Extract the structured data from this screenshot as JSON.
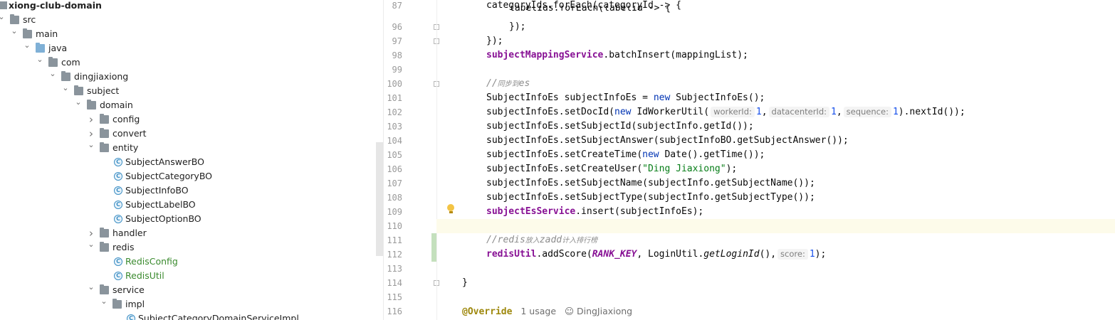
{
  "tree": {
    "root": "xiong-club-domain",
    "items": [
      {
        "label": "src",
        "depth": 0,
        "type": "folder",
        "chevron": "expanded"
      },
      {
        "label": "main",
        "depth": 1,
        "type": "folder",
        "chevron": "expanded"
      },
      {
        "label": "java",
        "depth": 2,
        "type": "src-folder",
        "chevron": "expanded"
      },
      {
        "label": "com",
        "depth": 3,
        "type": "folder",
        "chevron": "expanded"
      },
      {
        "label": "dingjiaxiong",
        "depth": 4,
        "type": "folder",
        "chevron": "expanded"
      },
      {
        "label": "subject",
        "depth": 5,
        "type": "folder",
        "chevron": "expanded"
      },
      {
        "label": "domain",
        "depth": 6,
        "type": "folder",
        "chevron": "expanded"
      },
      {
        "label": "config",
        "depth": 7,
        "type": "folder",
        "chevron": "collapsed"
      },
      {
        "label": "convert",
        "depth": 7,
        "type": "folder",
        "chevron": "collapsed"
      },
      {
        "label": "entity",
        "depth": 7,
        "type": "folder",
        "chevron": "expanded"
      },
      {
        "label": "SubjectAnswerBO",
        "depth": 8,
        "type": "class"
      },
      {
        "label": "SubjectCategoryBO",
        "depth": 8,
        "type": "class"
      },
      {
        "label": "SubjectInfoBO",
        "depth": 8,
        "type": "class"
      },
      {
        "label": "SubjectLabelBO",
        "depth": 8,
        "type": "class"
      },
      {
        "label": "SubjectOptionBO",
        "depth": 8,
        "type": "class"
      },
      {
        "label": "handler",
        "depth": 7,
        "type": "folder",
        "chevron": "collapsed"
      },
      {
        "label": "redis",
        "depth": 7,
        "type": "folder",
        "chevron": "expanded"
      },
      {
        "label": "RedisConfig",
        "depth": 8,
        "type": "class",
        "status": "added"
      },
      {
        "label": "RedisUtil",
        "depth": 8,
        "type": "class",
        "status": "added"
      },
      {
        "label": "service",
        "depth": 7,
        "type": "folder",
        "chevron": "expanded"
      },
      {
        "label": "impl",
        "depth": 8,
        "type": "folder",
        "chevron": "expanded"
      },
      {
        "label": "SubjectCategoryDomainServiceImpl",
        "depth": 9,
        "type": "class"
      }
    ]
  },
  "editor": {
    "lines": [
      {
        "n": "87",
        "indent": "inner",
        "code": "categoryIds.forEach(categoryId -> {"
      },
      {
        "n": "96",
        "indent": "inner2",
        "code": "});"
      },
      {
        "n": "97",
        "indent": "inner",
        "code": "});"
      },
      {
        "n": "98",
        "indent": "inner",
        "field": "subjectMappingService",
        "code": ".batchInsert(mappingList);"
      },
      {
        "n": "99"
      },
      {
        "n": "100",
        "indent": "inner",
        "comment": "//同步到es"
      },
      {
        "n": "101",
        "indent": "inner",
        "pre": "SubjectInfoEs subjectInfoEs = ",
        "kw": "new",
        "code": " SubjectInfoEs();"
      },
      {
        "n": "102",
        "indent": "inner",
        "pre": "subjectInfoEs.setDocId(",
        "kw": "new",
        "code": " IdWorkerUtil(",
        "hints": [
          {
            "name": "workerId:",
            "val": "1",
            "sep": ","
          },
          {
            "name": "datacenterId:",
            "val": "1",
            "sep": ","
          },
          {
            "name": "sequence:",
            "val": "1",
            "sep": ").nextId());"
          }
        ]
      },
      {
        "n": "103",
        "indent": "inner",
        "code": "subjectInfoEs.setSubjectId(subjectInfo.getId());"
      },
      {
        "n": "104",
        "indent": "inner",
        "code": "subjectInfoEs.setSubjectAnswer(subjectInfoBO.getSubjectAnswer());"
      },
      {
        "n": "105",
        "indent": "inner",
        "pre": "subjectInfoEs.setCreateTime(",
        "kw": "new",
        "code": " Date().getTime());"
      },
      {
        "n": "106",
        "indent": "inner",
        "pre": "subjectInfoEs.setCreateUser(",
        "str": "\"Ding Jiaxiong\"",
        "code": ");"
      },
      {
        "n": "107",
        "indent": "inner",
        "code": "subjectInfoEs.setSubjectName(subjectInfo.getSubjectName());"
      },
      {
        "n": "108",
        "indent": "inner",
        "code": "subjectInfoEs.setSubjectType(subjectInfo.getSubjectType());"
      },
      {
        "n": "109",
        "indent": "inner",
        "field": "subjectEsService",
        "code": ".insert(subjectInfoEs);"
      },
      {
        "n": "110",
        "current": true
      },
      {
        "n": "111",
        "indent": "inner",
        "comment": "//redis放入zadd计入排行榜"
      },
      {
        "n": "112",
        "indent": "inner",
        "field": "redisUtil",
        "code": ".addScore(",
        "static": "RANK_KEY",
        "post": ", LoginUtil.",
        "italic": "getLoginId",
        "post2": "(),",
        "hint": {
          "name": "score:",
          "val": "1",
          "sep": ");"
        }
      },
      {
        "n": "113"
      },
      {
        "n": "114",
        "indent": "outer",
        "code": "}"
      },
      {
        "n": "115"
      },
      {
        "n": "116",
        "indent": "outer",
        "annotation": "@Override",
        "usages": "1 usage",
        "author": "DingJiaxiong"
      }
    ],
    "overlap_fragment": "labelIds.forEach(labelId -> {"
  }
}
